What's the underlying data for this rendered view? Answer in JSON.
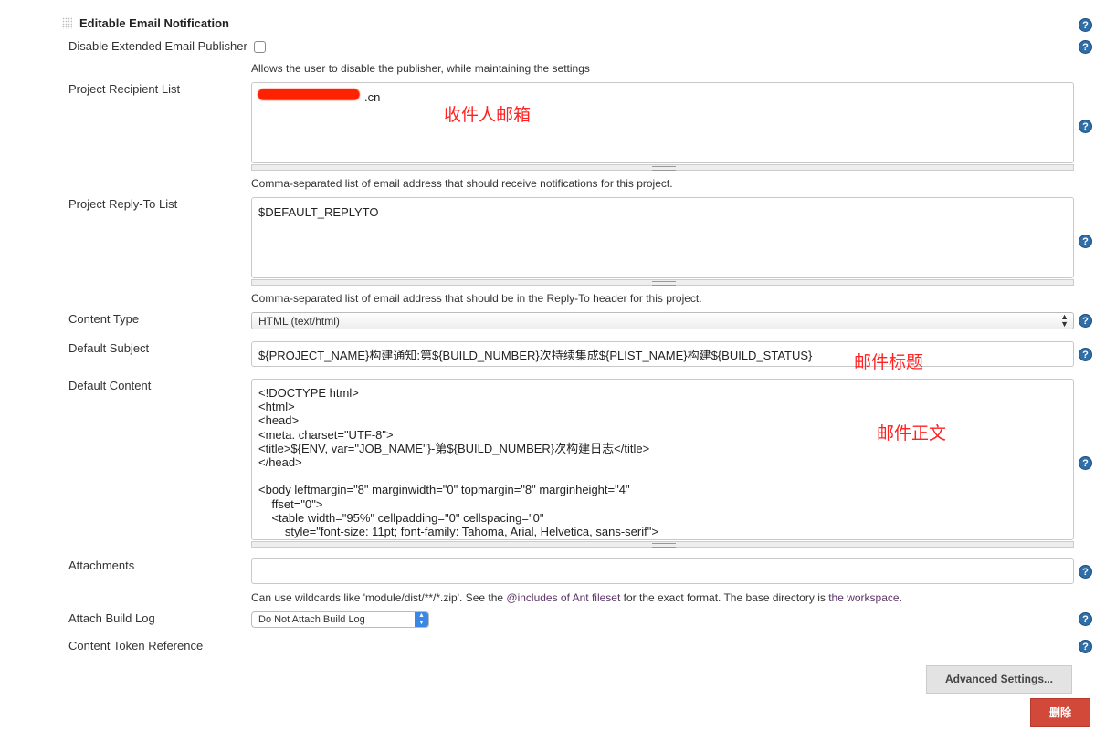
{
  "section": {
    "title": "Editable Email Notification",
    "icon": "drag-handle-icon"
  },
  "disable_publisher": {
    "label": "Disable Extended Email Publisher",
    "checked": false,
    "description": "Allows the user to disable the publisher, while maintaining the settings"
  },
  "recipient_list": {
    "label": "Project Recipient List",
    "value": ".cn",
    "annotation": "收件人邮箱",
    "description": "Comma-separated list of email address that should receive notifications for this project."
  },
  "reply_to": {
    "label": "Project Reply-To List",
    "value": "$DEFAULT_REPLYTO",
    "description": "Comma-separated list of email address that should be in the Reply-To header for this project."
  },
  "content_type": {
    "label": "Content Type",
    "value": "HTML (text/html)"
  },
  "default_subject": {
    "label": "Default Subject",
    "value": "${PROJECT_NAME}构建通知:第${BUILD_NUMBER}次持续集成${PLIST_NAME}构建${BUILD_STATUS}",
    "annotation": "邮件标题"
  },
  "default_content": {
    "label": "Default Content",
    "annotation": "邮件正文",
    "value": "<!DOCTYPE html>\n<html>\n<head>\n<meta. charset=\"UTF-8\">\n<title>${ENV, var=\"JOB_NAME\"}-第${BUILD_NUMBER}次构建日志</title>\n</head>\n\n<body leftmargin=\"8\" marginwidth=\"0\" topmargin=\"8\" marginheight=\"4\"\n    ffset=\"0\">\n    <table width=\"95%\" cellpadding=\"0\" cellspacing=\"0\"\n        style=\"font-size: 11pt; font-family: Tahoma, Arial, Helvetica, sans-serif\">"
  },
  "attachments": {
    "label": "Attachments",
    "value": "",
    "desc_pre": "Can use wildcards like 'module/dist/**/*.zip'. See the ",
    "link1": "@includes of Ant fileset",
    "desc_mid": " for the exact format. The base directory is ",
    "link2": "the workspace",
    "desc_post": "."
  },
  "attach_build_log": {
    "label": "Attach Build Log",
    "value": "Do Not Attach Build Log"
  },
  "content_token_reference": {
    "label": "Content Token Reference"
  },
  "buttons": {
    "advanced": "Advanced Settings...",
    "delete": "删除"
  },
  "help_icon": "?",
  "colors": {
    "delete": "#d24939",
    "annotation": "#ff2222",
    "help": "#2f6ea8",
    "redaction": "#ff2200"
  }
}
